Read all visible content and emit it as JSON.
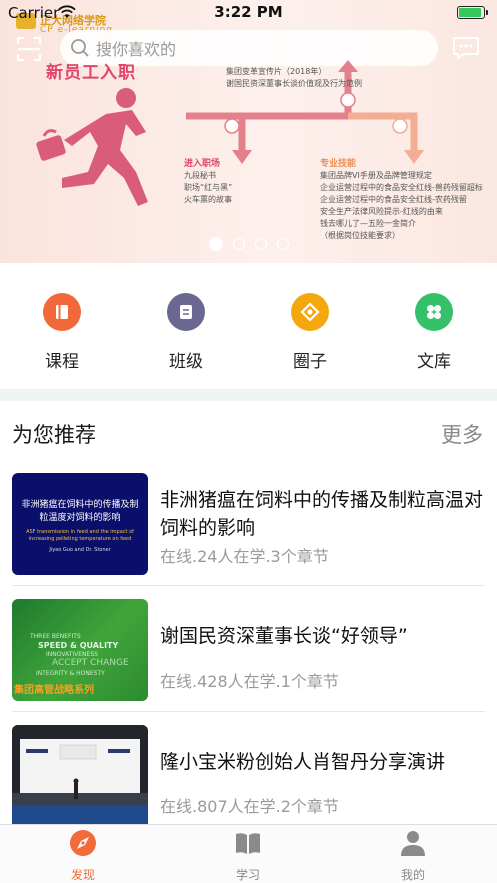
{
  "status_bar": {
    "carrier": "Carrier",
    "time": "3:22 PM"
  },
  "banner": {
    "brand_name": "正大网络学院",
    "brand_sub": "CP e-learning",
    "slogan": "新员工入职",
    "flow": {
      "top_lines": [
        "集团变革宣传片（2018年）",
        "谢国民资深董事长谈价值观及行为范例"
      ],
      "left_head": "进入职场",
      "left_lines": [
        "九段秘书",
        "职场“红与黑”",
        "火车票的故事"
      ],
      "right_head": "专业技能",
      "right_lines": [
        "集团品牌VI手册及品牌管理规定",
        "企业运营过程中的食品安全红线-兽药残留超标",
        "企业运营过程中的食品安全红线-农药残留",
        "安全生产法律风险提示-红线的由来",
        "钱去哪儿了—五险一金简介",
        "（根据岗位技能要求）"
      ]
    },
    "dots": 4,
    "active_dot": 0
  },
  "search": {
    "placeholder": "搜你喜欢的"
  },
  "quick_nav": [
    {
      "label": "课程",
      "color": "#f2683a",
      "icon": "book-icon"
    },
    {
      "label": "班级",
      "color": "#6a6890",
      "icon": "class-icon"
    },
    {
      "label": "圈子",
      "color": "#f5a80d",
      "icon": "circle-icon"
    },
    {
      "label": "文库",
      "color": "#35c06a",
      "icon": "library-icon"
    }
  ],
  "recommend": {
    "title": "为您推荐",
    "more": "更多",
    "courses": [
      {
        "title": "非洲猪瘟在饲料中的传播及制粒高温对饲料的影响",
        "meta": "在线.24人在学.3个章节",
        "thumb_title": "非洲猪瘟在饲料中的传播及制粒温度对饲料的影响",
        "thumb_sub": "ASF transmission in feed and the impact of increasing pelleting temperature on feed",
        "thumb_author": "Jiyao Guo and Dr. Stoner"
      },
      {
        "title": "谢国民资深董事长谈“好领导”",
        "meta": "在线.428人在学.1个章节",
        "thumb_words": [
          "THREE BENEFITS",
          "SPEED & QUALITY",
          "INNOVATIVENESS",
          "ACCEPT CHANGE",
          "INTEGRITY & HONESTY"
        ],
        "thumb_tag": "集团高管战略系列"
      },
      {
        "title": "隆小宝米粉创始人肖智丹分享演讲",
        "meta": "在线.807人在学.2个章节"
      }
    ]
  },
  "tabbar": [
    {
      "label": "发现",
      "active": true
    },
    {
      "label": "学习",
      "active": false
    },
    {
      "label": "我的",
      "active": false
    }
  ]
}
